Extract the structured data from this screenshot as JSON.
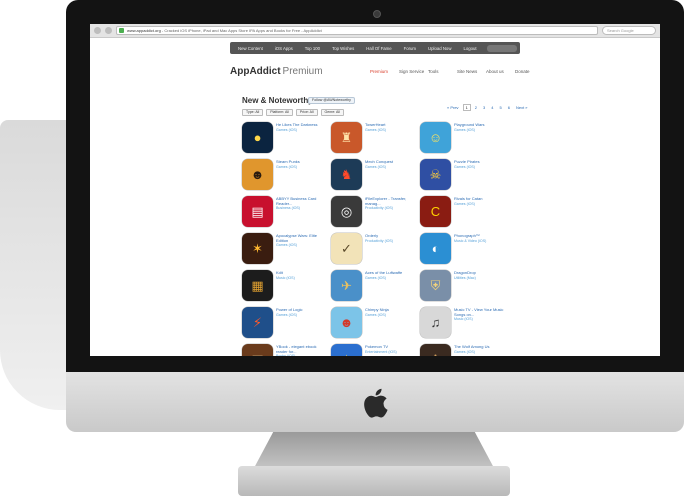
{
  "browser": {
    "url_host": "www.appaddict.org",
    "url_rest": " - Cracked iOS iPhone, iPad and Mac Apps Store IPA Apps and Books for Free - AppAddict",
    "search_placeholder": "Search Google"
  },
  "topnav": [
    "New Content",
    "iOS Apps",
    "Top 100",
    "Top Wishes",
    "Hall Of Fame",
    "Forum",
    "Upload Now",
    "Logout"
  ],
  "logo": {
    "name": "AppAddict",
    "premium": "Premium"
  },
  "subnav": [
    {
      "label": "Premium",
      "active": true
    },
    {
      "label": "Sign Service",
      "active": false
    },
    {
      "label": "Tools",
      "active": false
    },
    {
      "label": "Site News",
      "active": false
    },
    {
      "label": "About us",
      "active": false
    },
    {
      "label": "Donate",
      "active": false
    }
  ],
  "section": {
    "title": "New & Noteworthy",
    "follow": "Follow @AWNoteworthy"
  },
  "filters": [
    "Type: All",
    "Platform: All",
    "Price: All",
    "Genre: All"
  ],
  "pager": {
    "prev": "« Prev",
    "pages": [
      "1",
      "2",
      "3",
      "4",
      "5",
      "6"
    ],
    "current": "1",
    "next": "Next »"
  },
  "apps": [
    {
      "name": "He Likes The Darkness",
      "cat": "Games (iOS)",
      "bg": "#0b2440",
      "fg": "#ffd84a",
      "glyph": "●"
    },
    {
      "name": "TowerHeart",
      "cat": "Games (iOS)",
      "bg": "#c9582a",
      "fg": "#ffe2a8",
      "glyph": "♜"
    },
    {
      "name": "Playground Wars",
      "cat": "Games (iOS)",
      "bg": "#3fa3d9",
      "fg": "#ffe45c",
      "glyph": "☺"
    },
    {
      "name": "Steam Punks",
      "cat": "Games (iOS)",
      "bg": "#e0962d",
      "fg": "#2b1c10",
      "glyph": "☻"
    },
    {
      "name": "Mech Conquest",
      "cat": "Games (iOS)",
      "bg": "#1d3b57",
      "fg": "#ff4a2a",
      "glyph": "♞"
    },
    {
      "name": "Puzzle Pirates",
      "cat": "Games (iOS)",
      "bg": "#2f4fa3",
      "fg": "#ffcf3a",
      "glyph": "☠"
    },
    {
      "name": "ABBYY Business Card Reader...",
      "cat": "Business (iOS)",
      "bg": "#c8102e",
      "fg": "#ffffff",
      "glyph": "▤"
    },
    {
      "name": "iFileExplorer - Transfer, manag...",
      "cat": "Productivity (iOS)",
      "bg": "#3a3a3a",
      "fg": "#ffffff",
      "glyph": "◎"
    },
    {
      "name": "Rivals for Catan",
      "cat": "Games (iOS)",
      "bg": "#8a1c12",
      "fg": "#ffd200",
      "glyph": "C"
    },
    {
      "name": "Apocalypse Wars: Elite Edition",
      "cat": "Games (iOS)",
      "bg": "#3a1d10",
      "fg": "#ffb830",
      "glyph": "✶"
    },
    {
      "name": "Orderly",
      "cat": "Productivity (iOS)",
      "bg": "#f2e3b8",
      "fg": "#5a4a2a",
      "glyph": "✓"
    },
    {
      "name": "Phonograph™",
      "cat": "Music & Video (iOS)",
      "bg": "#2b8fd3",
      "fg": "#ffffff",
      "glyph": "◐"
    },
    {
      "name": "Kdit",
      "cat": "Music (iOS)",
      "bg": "#1c1c1c",
      "fg": "#e0a030",
      "glyph": "▦"
    },
    {
      "name": "Aces of the Luftwaffe",
      "cat": "Games (iOS)",
      "bg": "#4a90c9",
      "fg": "#e8c060",
      "glyph": "✈"
    },
    {
      "name": "DragonDrop",
      "cat": "Utilities (Mac)",
      "bg": "#7a8fa8",
      "fg": "#f3d27a",
      "glyph": "⛨"
    },
    {
      "name": "Power of Logic",
      "cat": "Games (iOS)",
      "bg": "#1f4f8a",
      "fg": "#ff5a2a",
      "glyph": "⚡"
    },
    {
      "name": "Chimpy Ninja",
      "cat": "Games (iOS)",
      "bg": "#7cc4e8",
      "fg": "#d4382a",
      "glyph": "☻"
    },
    {
      "name": "Music TV - View Your Music Songs on...",
      "cat": "Music (iOS)",
      "bg": "#d8d8d8",
      "fg": "#333333",
      "glyph": "♫"
    },
    {
      "name": "YBook - elegant ebook reader for...",
      "cat": "Books (iOS)",
      "bg": "#6a3b1c",
      "fg": "#f3d9a4",
      "glyph": "▥"
    },
    {
      "name": "Pokemon TV",
      "cat": "Entertainment (iOS)",
      "bg": "#2b6fcf",
      "fg": "#ffd84a",
      "glyph": "★"
    },
    {
      "name": "The Wolf Among Us",
      "cat": "Games (iOS)",
      "bg": "#3a2a20",
      "fg": "#c99a5a",
      "glyph": "♟"
    }
  ]
}
